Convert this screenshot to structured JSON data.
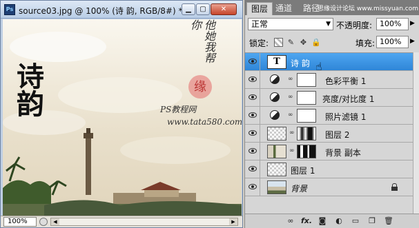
{
  "document": {
    "app_badge": "Ps",
    "title": "source03.jpg @ 100% (诗   韵, RGB/8#) *",
    "minimize_icon": "minimize-icon",
    "maximize_icon": "maximize-icon",
    "close_icon": "close-icon",
    "canvas": {
      "poem_title": "诗韵",
      "signature_vertical": "他她我帮你",
      "watermark_line1": "PS教程网",
      "watermark_line2": "www.tata580.com"
    },
    "status": {
      "zoom": "100%"
    }
  },
  "panel": {
    "tabs": [
      "图层",
      "通道",
      "路径"
    ],
    "banner": "思缘设计论坛 www.missyuan.com",
    "blend_mode": "正常",
    "opacity_label": "不透明度:",
    "opacity_value": "100%",
    "lock_label": "锁定:",
    "fill_label": "填充:",
    "fill_value": "100%",
    "layers": [
      {
        "name": "诗 韵",
        "type": "text",
        "thumb_text": "T",
        "selected": true
      },
      {
        "name": "色彩平衡 1",
        "type": "adjustment"
      },
      {
        "name": "亮度/对比度 1",
        "type": "adjustment"
      },
      {
        "name": "照片滤镜 1",
        "type": "adjustment"
      },
      {
        "name": "图层 2",
        "type": "layer_mask"
      },
      {
        "name": "背景 副本",
        "type": "layer_mask"
      },
      {
        "name": "图层 1",
        "type": "layer"
      },
      {
        "name": "背景",
        "type": "background",
        "locked": true
      }
    ],
    "footer_icons": [
      "link-layers-icon",
      "fx-icon",
      "add-mask-icon",
      "adjustment-layer-icon",
      "new-group-icon",
      "new-layer-icon",
      "delete-layer-icon"
    ],
    "footer_labels": {
      "fx": "fx."
    }
  },
  "colors": {
    "selected_layer": "#3a93e2",
    "close_button": "#c6452b"
  }
}
